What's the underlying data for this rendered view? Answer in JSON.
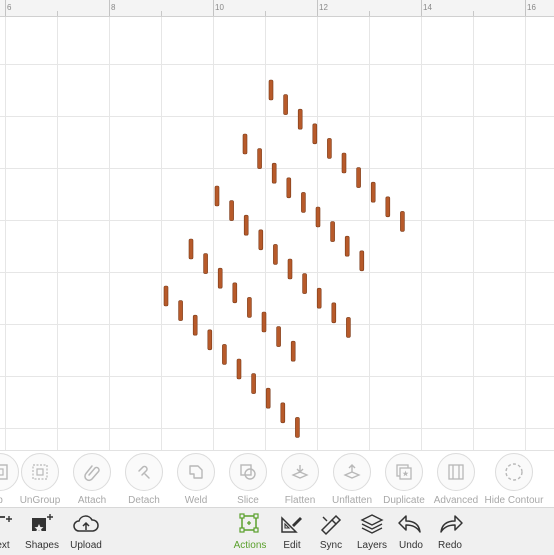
{
  "ruler": {
    "numbers": [
      "6",
      "8",
      "10",
      "12",
      "14",
      "16"
    ]
  },
  "canvas": {
    "shape_color": "#b75a2a"
  },
  "action_bar": {
    "items": [
      {
        "label": "p",
        "icon": "group-icon"
      },
      {
        "label": "UnGroup",
        "icon": "ungroup-icon"
      },
      {
        "label": "Attach",
        "icon": "paperclip-icon"
      },
      {
        "label": "Detach",
        "icon": "detach-icon"
      },
      {
        "label": "Weld",
        "icon": "weld-icon"
      },
      {
        "label": "Slice",
        "icon": "slice-icon"
      },
      {
        "label": "Flatten",
        "icon": "flatten-icon"
      },
      {
        "label": "Unflatten",
        "icon": "unflatten-icon"
      },
      {
        "label": "Duplicate",
        "icon": "duplicate-icon"
      },
      {
        "label": "Advanced",
        "icon": "advanced-icon"
      },
      {
        "label": "Hide Contour",
        "icon": "hide-contour-icon"
      }
    ]
  },
  "toolbar": {
    "active_color": "#5aa02c",
    "items": [
      {
        "label": "ext",
        "icon": "text-icon"
      },
      {
        "label": "Shapes",
        "icon": "shapes-icon"
      },
      {
        "label": "Upload",
        "icon": "upload-icon"
      },
      {
        "label": "Actions",
        "icon": "actions-icon",
        "active": true
      },
      {
        "label": "Edit",
        "icon": "edit-icon"
      },
      {
        "label": "Sync",
        "icon": "sync-icon"
      },
      {
        "label": "Layers",
        "icon": "layers-icon"
      },
      {
        "label": "Undo",
        "icon": "undo-icon"
      },
      {
        "label": "Redo",
        "icon": "redo-icon"
      }
    ]
  }
}
